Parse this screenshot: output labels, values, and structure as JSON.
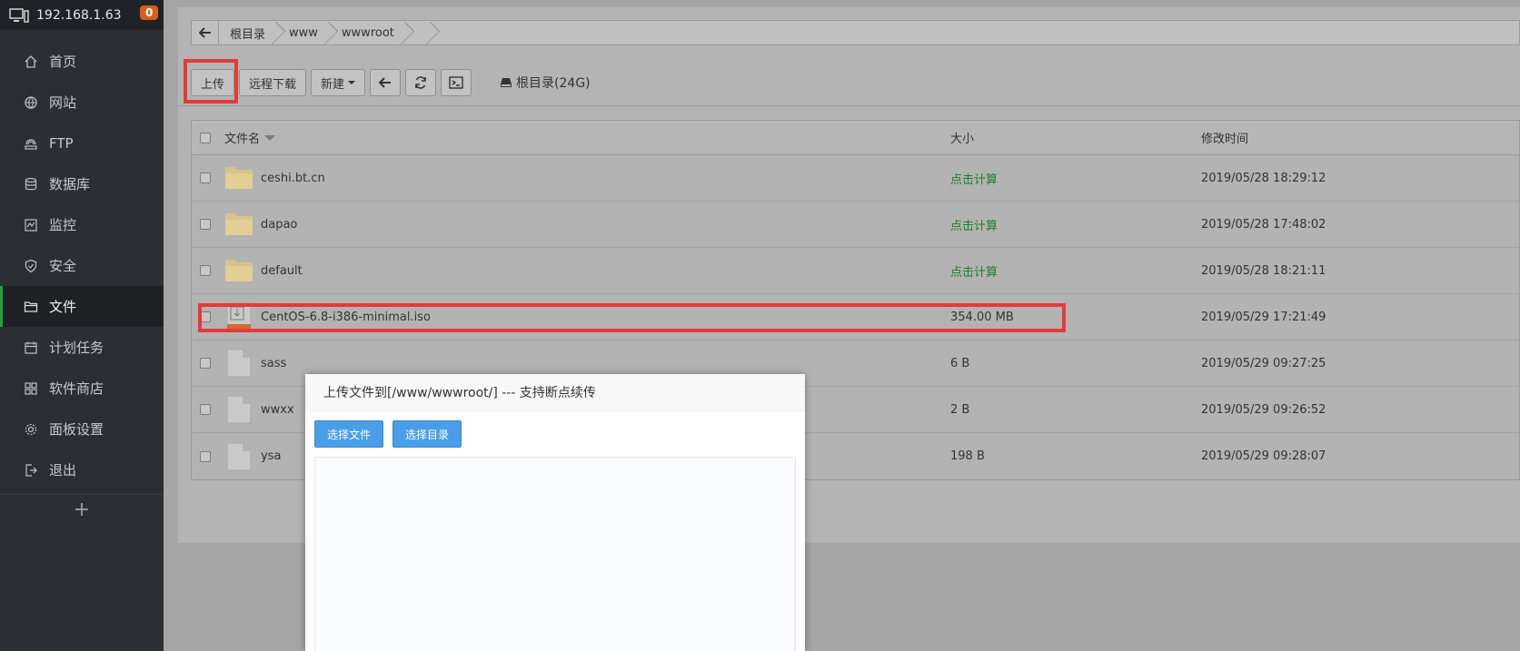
{
  "sidebar": {
    "host": "192.168.1.63",
    "badge": "0",
    "items": [
      {
        "label": "首页",
        "icon": "home-icon",
        "active": false
      },
      {
        "label": "网站",
        "icon": "globe-icon",
        "active": false
      },
      {
        "label": "FTP",
        "icon": "ftp-icon",
        "active": false
      },
      {
        "label": "数据库",
        "icon": "database-icon",
        "active": false
      },
      {
        "label": "监控",
        "icon": "monitor-icon",
        "active": false
      },
      {
        "label": "安全",
        "icon": "shield-icon",
        "active": false
      },
      {
        "label": "文件",
        "icon": "folder-icon",
        "active": true
      },
      {
        "label": "计划任务",
        "icon": "calendar-icon",
        "active": false
      },
      {
        "label": "软件商店",
        "icon": "grid-icon",
        "active": false
      },
      {
        "label": "面板设置",
        "icon": "gear-icon",
        "active": false
      },
      {
        "label": "退出",
        "icon": "logout-icon",
        "active": false
      }
    ],
    "add": "+"
  },
  "breadcrumb": [
    "根目录",
    "www",
    "wwwroot"
  ],
  "toolbar": {
    "upload": "上传",
    "remote_download": "远程下载",
    "new": "新建",
    "disk": "根目录(24G)"
  },
  "table": {
    "headers": {
      "name": "文件名",
      "size": "大小",
      "mtime": "修改时间"
    },
    "rows": [
      {
        "name": "ceshi.bt.cn",
        "type": "folder",
        "size": "点击计算",
        "mtime": "2019/05/28 18:29:12"
      },
      {
        "name": "dapao",
        "type": "folder",
        "size": "点击计算",
        "mtime": "2019/05/28 17:48:02"
      },
      {
        "name": "default",
        "type": "folder",
        "size": "点击计算",
        "mtime": "2019/05/28 18:21:11"
      },
      {
        "name": "CentOS-6.8-i386-minimal.iso",
        "type": "iso",
        "size": "354.00 MB",
        "mtime": "2019/05/29 17:21:49"
      },
      {
        "name": "sass",
        "type": "file",
        "size": "6 B",
        "mtime": "2019/05/29 09:27:25"
      },
      {
        "name": "wwxx",
        "type": "file",
        "size": "2 B",
        "mtime": "2019/05/29 09:26:52"
      },
      {
        "name": "ysa",
        "type": "file",
        "size": "198 B",
        "mtime": "2019/05/29 09:28:07"
      }
    ]
  },
  "modal": {
    "title": "上传文件到[/www/wwwroot/] --- 支持断点续传",
    "choose_file": "选择文件",
    "choose_dir": "选择目录"
  },
  "colors": {
    "accent_green": "#20a53a",
    "highlight_red": "#e53a3a",
    "button_blue": "#4a9ee8",
    "badge_orange": "#d4601f"
  }
}
